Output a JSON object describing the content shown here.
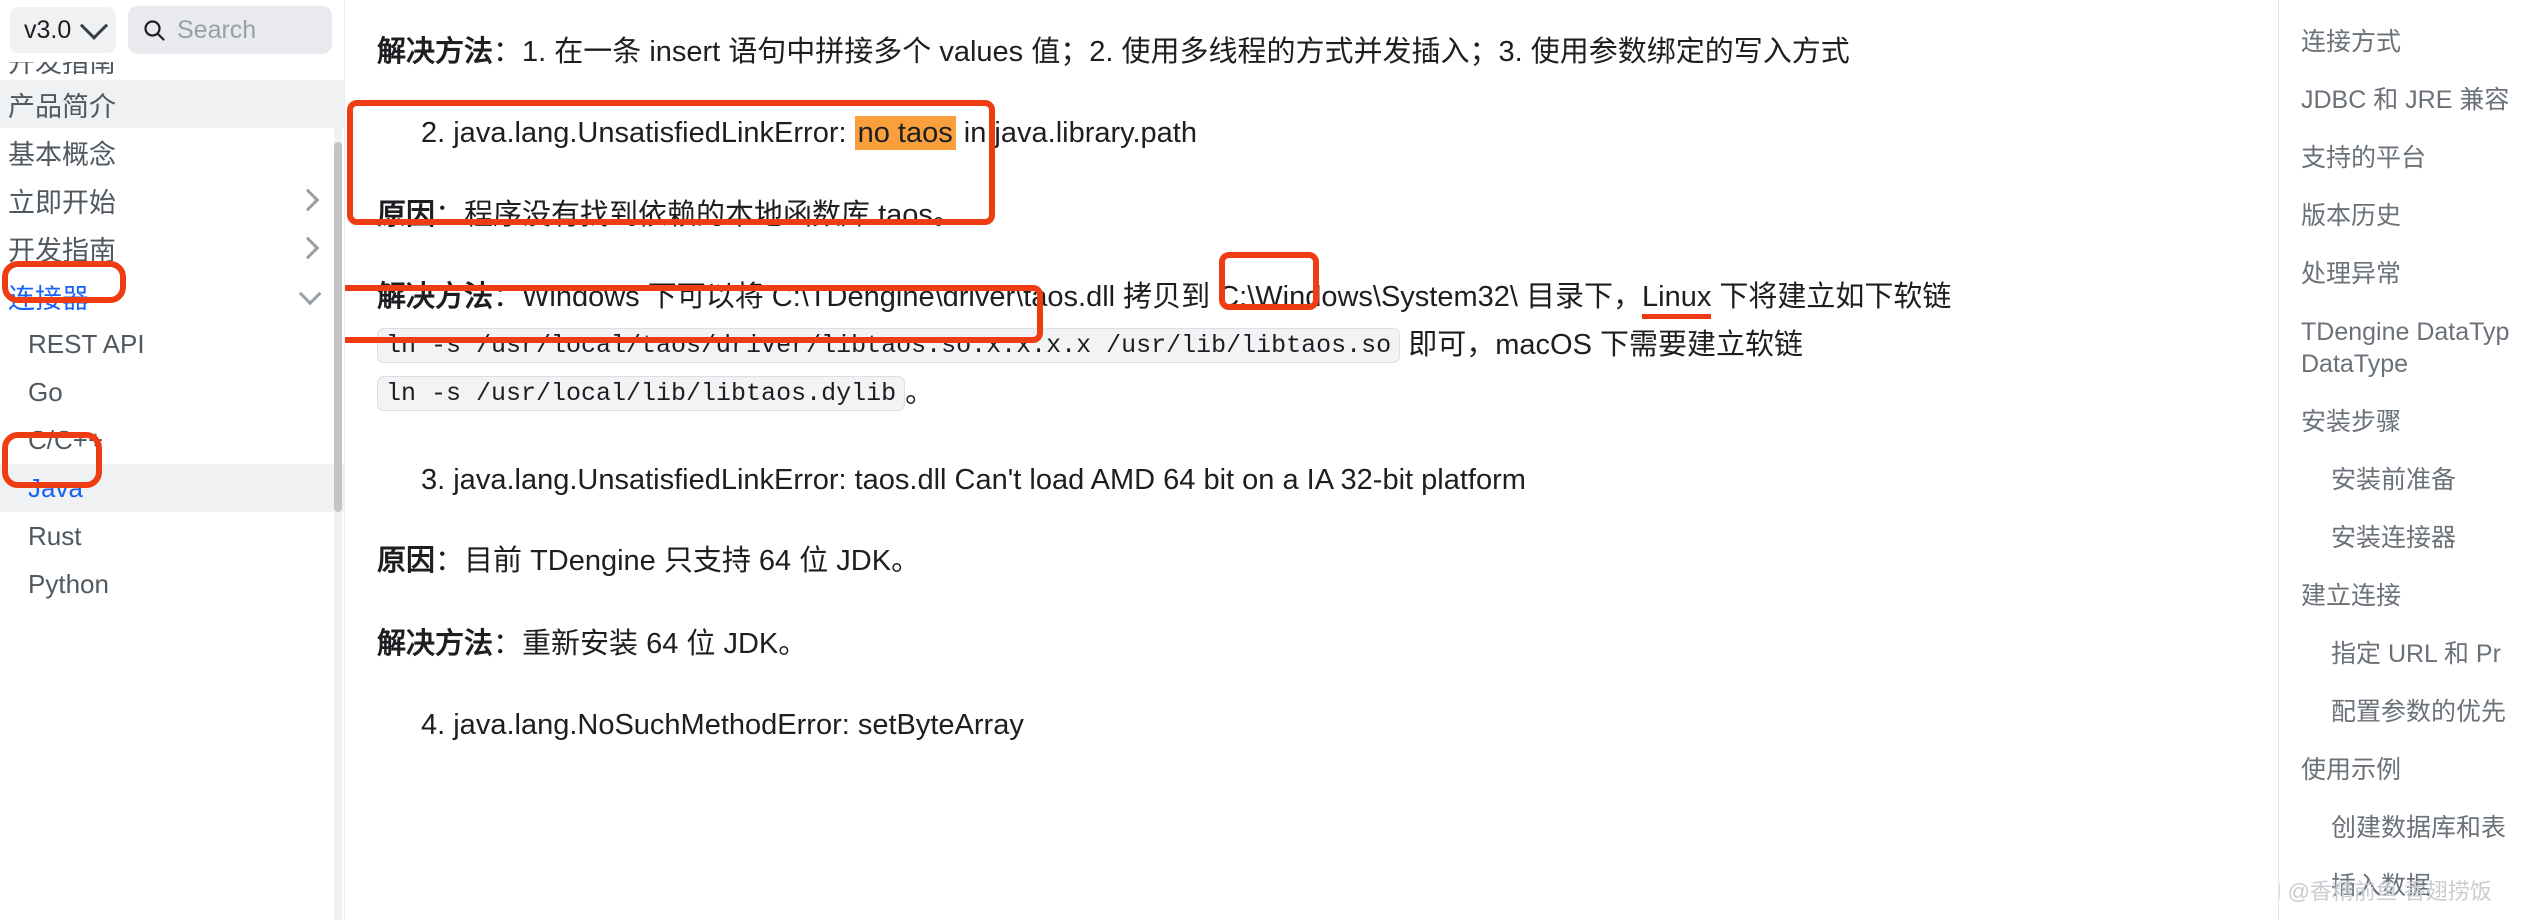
{
  "sidebar": {
    "version": {
      "label": "v3.0",
      "icon": "chevron-down-icon"
    },
    "search": {
      "placeholder": "Search",
      "icon": "search-icon"
    },
    "clipped_item": "开发指南",
    "items": [
      {
        "label": "产品简介",
        "level": 1,
        "state": "hover"
      },
      {
        "label": "基本概念",
        "level": 1,
        "state": "normal"
      },
      {
        "label": "立即开始",
        "level": 1,
        "state": "normal",
        "chevron": "chevron-right-icon"
      },
      {
        "label": "开发指南",
        "level": 1,
        "state": "normal",
        "chevron": "chevron-right-icon"
      },
      {
        "label": "连接器",
        "level": 1,
        "state": "expanded-blue",
        "chevron": "chevron-down-icon",
        "annotated": true
      },
      {
        "label": "REST API",
        "level": 2,
        "state": "normal"
      },
      {
        "label": "Go",
        "level": 2,
        "state": "normal"
      },
      {
        "label": "C/C++",
        "level": 2,
        "state": "normal"
      },
      {
        "label": "Java",
        "level": 2,
        "state": "active",
        "annotated": true
      },
      {
        "label": "Rust",
        "level": 2,
        "state": "normal"
      },
      {
        "label": "Python",
        "level": 2,
        "state": "normal"
      }
    ]
  },
  "content": {
    "p1": {
      "bold": "解决方法",
      "text": "：1. 在一条 insert 语句中拼接多个 values 值；2. 使用多线程的方式并发插入；3. 使用参数绑定的写入方式"
    },
    "item2": {
      "prefix": "2. java.lang.UnsatisfiedLinkError: ",
      "highlight": "no taos",
      "suffix": " in java.library.path"
    },
    "cause2": {
      "bold": "原因",
      "text": "：程序没有找到依赖的本地函数库 taos。"
    },
    "solution2": {
      "bold": "解决方法",
      "seg1": "：Windows 下可以将 C:\\TDengine\\driver\\taos.dll 拷贝到 C:\\Windows\\System32\\ 目录下，",
      "underlined": "Linux",
      "seg2": " 下将建立如下软链 ",
      "code1": "ln -s /usr/local/taos/driver/libtaos.so.x.x.x.x /usr/lib/libtaos.so",
      "seg3": " 即可，",
      "boxed": "macOS",
      "seg4": " 下需要建立软链 ",
      "code2": "ln -s /usr/local/lib/libtaos.dylib",
      "seg5": "。"
    },
    "item3": "3. java.lang.UnsatisfiedLinkError: taos.dll Can't load AMD 64 bit on a IA 32-bit platform",
    "cause3": {
      "bold": "原因",
      "text": "：目前 TDengine 只支持 64 位 JDK。"
    },
    "solution3": {
      "bold": "解决方法",
      "text": "：重新安装 64 位 JDK。"
    },
    "item4": "4. java.lang.NoSuchMethodError: setByteArray"
  },
  "toc": {
    "items": [
      {
        "label": "连接方式",
        "indent": 0
      },
      {
        "label": "JDBC 和 JRE 兼容",
        "indent": 0
      },
      {
        "label": "支持的平台",
        "indent": 0
      },
      {
        "label": "版本历史",
        "indent": 0
      },
      {
        "label": "处理异常",
        "indent": 0
      },
      {
        "label": "TDengine DataTyp DataType",
        "indent": 0,
        "wrap": true
      },
      {
        "label": "安装步骤",
        "indent": 0
      },
      {
        "label": "安装前准备",
        "indent": 1
      },
      {
        "label": "安装连接器",
        "indent": 1
      },
      {
        "label": "建立连接",
        "indent": 0
      },
      {
        "label": "指定 URL 和 Pr",
        "indent": 1
      },
      {
        "label": "配置参数的优先",
        "indent": 1
      },
      {
        "label": "使用示例",
        "indent": 0
      },
      {
        "label": "创建数据库和表",
        "indent": 1
      },
      {
        "label": "插入数据",
        "indent": 1
      }
    ]
  },
  "watermark": "CSDN @香精前鱼 香翅捞饭",
  "colors": {
    "annotation_red": "#f03c12",
    "highlight_orange": "#f9a03c",
    "active_blue": "#1763f6",
    "text": "#1c1e21",
    "muted": "#6b7178"
  }
}
